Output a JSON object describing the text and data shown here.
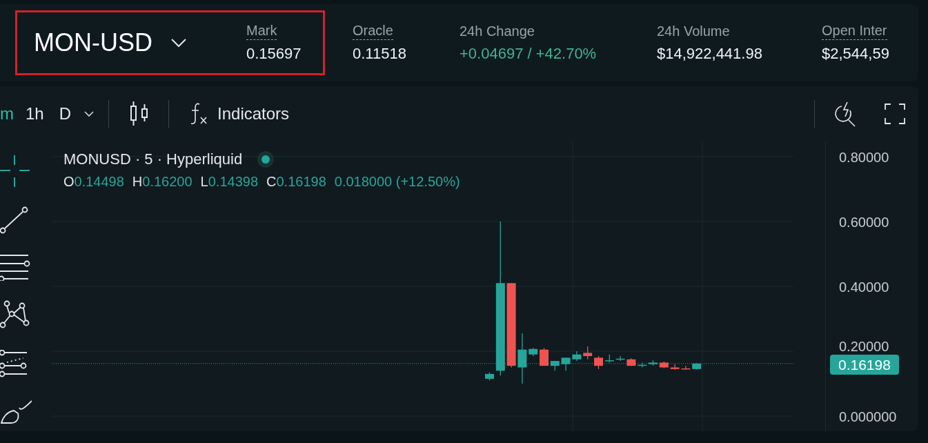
{
  "market": {
    "symbol": "MON-USD",
    "highlighted": true
  },
  "stats": [
    {
      "label": "Mark",
      "value": "0.15697",
      "dashed": true,
      "color": "#f0f3f4"
    },
    {
      "label": "Oracle",
      "value": "0.11518",
      "dashed": true,
      "color": "#f0f3f4"
    },
    {
      "label": "24h Change",
      "value": "+0.04697 / +42.70%",
      "dashed": false,
      "color": "#3fb68b"
    },
    {
      "label": "24h Volume",
      "value": "$14,922,441.98",
      "dashed": false,
      "color": "#f0f3f4"
    },
    {
      "label": "Open Inter",
      "value": "$2,544,59",
      "dashed": true,
      "color": "#f0f3f4"
    }
  ],
  "toolbar": {
    "intervals": [
      {
        "label": "m",
        "selected": true
      },
      {
        "label": "1h",
        "selected": false
      },
      {
        "label": "D",
        "selected": false
      }
    ],
    "indicators": "Indicators"
  },
  "legend": {
    "title": "MONUSD · 5 · Hyperliquid",
    "live": true,
    "ohlc": [
      {
        "key": "O",
        "value": "0.14498"
      },
      {
        "key": "H",
        "value": "0.16200"
      },
      {
        "key": "L",
        "value": "0.14398"
      },
      {
        "key": "C",
        "value": "0.16198"
      }
    ],
    "change": "0.018000 (+12.50%)"
  },
  "price_axis": [
    "0.80000",
    "0.60000",
    "0.40000",
    "0.20000",
    "0.000000"
  ],
  "last_price": "0.16198"
}
